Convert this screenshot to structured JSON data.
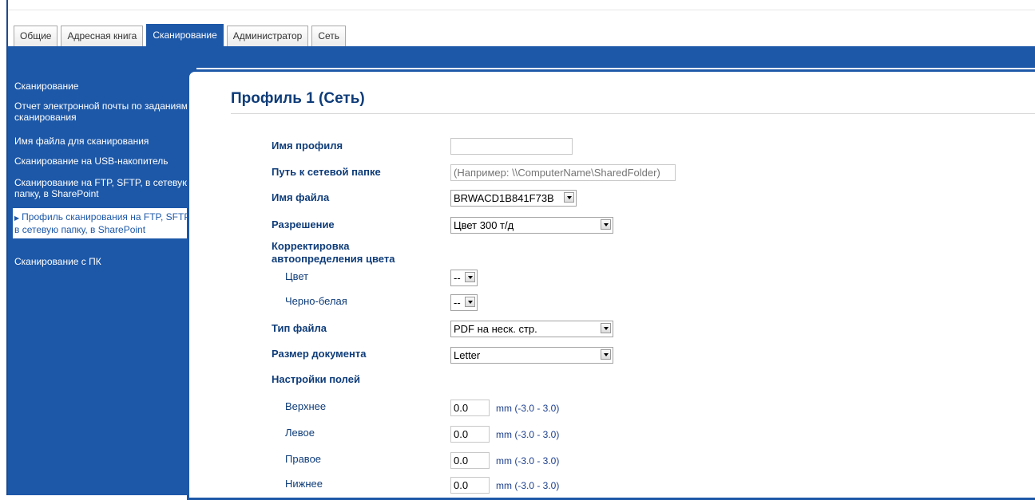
{
  "tabs": [
    {
      "label": "Общие"
    },
    {
      "label": "Адресная книга"
    },
    {
      "label": "Сканирование"
    },
    {
      "label": "Администратор"
    },
    {
      "label": "Сеть"
    }
  ],
  "sidebar": {
    "items": [
      {
        "label": "Сканирование"
      },
      {
        "label": "Отчет электронной почты по заданиям сканирования"
      },
      {
        "label": "Имя файла для сканирования"
      },
      {
        "label": "Сканирование на USB-накопитель"
      },
      {
        "label": "Сканирование на FTP, SFTP, в сетевую папку, в SharePoint"
      },
      {
        "label": "Профиль сканирования на FTP, SFTP, в сетевую папку, в SharePoint"
      },
      {
        "label": "Сканирование с ПК"
      }
    ]
  },
  "page": {
    "title": "Профиль 1 (Сеть)"
  },
  "form": {
    "profile_name": {
      "label": "Имя профиля",
      "value": ""
    },
    "network_path": {
      "label": "Путь к сетевой папке",
      "placeholder": "(Например: \\\\ComputerName\\SharedFolder)"
    },
    "file_name": {
      "label": "Имя файла",
      "value": "BRWACD1B841F73B"
    },
    "resolution": {
      "label": "Разрешение",
      "value": "Цвет 300 т/д"
    },
    "auto_color": {
      "label": "Корректировка автоопределения цвета",
      "color": {
        "label": "Цвет",
        "value": "--"
      },
      "bw": {
        "label": "Черно-белая",
        "value": "--"
      }
    },
    "file_type": {
      "label": "Тип файла",
      "value": "PDF на неск. стр."
    },
    "doc_size": {
      "label": "Размер документа",
      "value": "Letter"
    },
    "margins": {
      "label": "Настройки полей",
      "top": {
        "label": "Верхнее",
        "value": "0.0",
        "hint": "mm (-3.0 - 3.0)"
      },
      "left": {
        "label": "Левое",
        "value": "0.0",
        "hint": "mm (-3.0 - 3.0)"
      },
      "right": {
        "label": "Правое",
        "value": "0.0",
        "hint": "mm (-3.0 - 3.0)"
      },
      "bottom": {
        "label": "Нижнее",
        "value": "0.0",
        "hint": "mm (-3.0 - 3.0)"
      }
    }
  },
  "colors": {
    "accent": "#1d58a8",
    "label": "#0e3c79"
  }
}
